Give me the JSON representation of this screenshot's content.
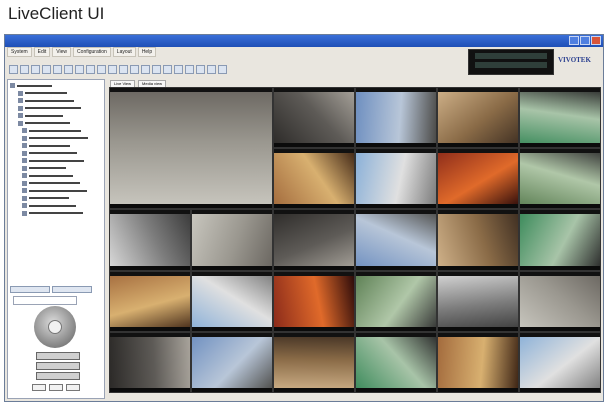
{
  "caption": "LiveClient UI",
  "brand": "VIVOTEK",
  "menus": [
    {
      "label": "System"
    },
    {
      "label": "Edit"
    },
    {
      "label": "View"
    },
    {
      "label": "Configuration"
    },
    {
      "label": "Layout"
    },
    {
      "label": "Help"
    }
  ],
  "tabs": [
    {
      "label": "Live View"
    },
    {
      "label": "Media view"
    }
  ],
  "colors": {
    "accent": "#2a3f8f",
    "titlebar": "#1e4fb6",
    "panel_bg": "#e9e6df",
    "grid_bg": "#000000"
  },
  "tree_rows": 18,
  "tiles_count": 28
}
